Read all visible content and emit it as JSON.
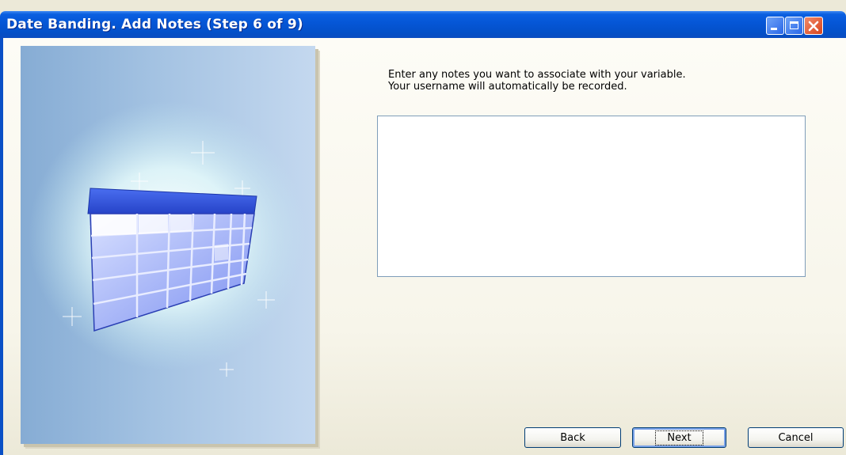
{
  "window": {
    "title": "Date Banding.  Add Notes (Step 6 of 9)",
    "controls": {
      "minimize_icon": "minimize-icon",
      "maximize_icon": "maximize-icon",
      "close_icon": "close-icon"
    }
  },
  "illustration": {
    "icon": "table-grid-illustration"
  },
  "instructions": {
    "line1": "Enter any notes you want to associate with your variable.",
    "line2": "Your username will automatically be recorded."
  },
  "notes": {
    "value": ""
  },
  "buttons": {
    "back": "Back",
    "next": "Next",
    "cancel": "Cancel"
  },
  "colors": {
    "titlebar": "#0556d6",
    "close": "#d9441c",
    "panel": "#a3c2e2",
    "table_header": "#3152d8"
  }
}
